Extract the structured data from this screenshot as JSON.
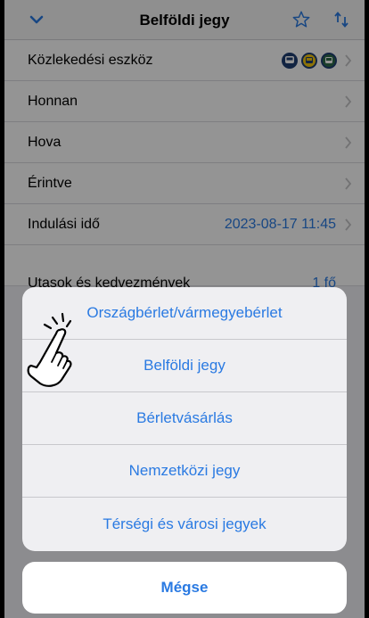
{
  "header": {
    "title": "Belföldi jegy",
    "icons": [
      "chevron-down-icon",
      "star-outline-icon",
      "swap-vertical-icon"
    ]
  },
  "rows": [
    {
      "label": "Közlekedési eszköz",
      "value": ""
    },
    {
      "label": "Honnan",
      "value": ""
    },
    {
      "label": "Hova",
      "value": ""
    },
    {
      "label": "Érintve",
      "value": ""
    },
    {
      "label": "Indulási idő",
      "value": "2023-08-17 11:45"
    }
  ],
  "partially_hidden_row": {
    "label": "Utasok és kedvezmények",
    "value": "1 fő"
  },
  "action_sheet": {
    "items": [
      "Országbérlet/vármegyebérlet",
      "Belföldi jegy",
      "Bérletvásárlás",
      "Nemzetközi jegy",
      "Térségi és városi jegyek"
    ],
    "cancel": "Mégse"
  },
  "colors": {
    "accent": "#2a7ae2",
    "transport_train": "#1f3f73",
    "transport_bus": "#f1c40f",
    "transport_tram": "#2d6b4a"
  }
}
